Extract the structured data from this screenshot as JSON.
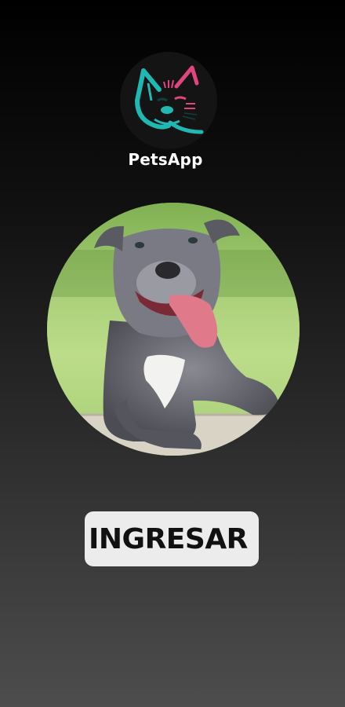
{
  "app": {
    "name": "PetsApp"
  },
  "logo": {
    "icon": "french-bulldog-logo-icon",
    "colors": {
      "teal": "#1fb8b3",
      "pink": "#e0457f"
    }
  },
  "hero": {
    "image": "smiling-pitbull-dog-photo"
  },
  "actions": {
    "enter_label": "INGRESAR"
  },
  "colors": {
    "background_top": "#000000",
    "background_bottom": "#4d4d4d",
    "button_bg": "#ececec",
    "button_text": "#111111"
  }
}
